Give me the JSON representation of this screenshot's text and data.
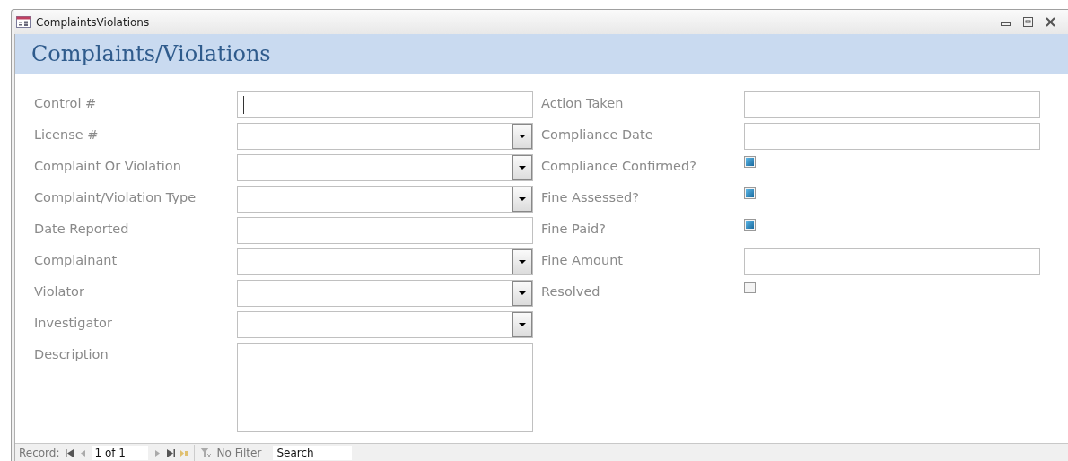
{
  "window": {
    "title": "ComplaintsViolations"
  },
  "header": {
    "title": "Complaints/Violations"
  },
  "left_fields": [
    {
      "label": "Control #",
      "kind": "text",
      "focused": true
    },
    {
      "label": "License #",
      "kind": "combo"
    },
    {
      "label": "Complaint Or Violation",
      "kind": "combo"
    },
    {
      "label": "Complaint/Violation Type",
      "kind": "combo"
    },
    {
      "label": "Date Reported",
      "kind": "text"
    },
    {
      "label": "Complainant",
      "kind": "combo"
    },
    {
      "label": "Violator",
      "kind": "combo"
    },
    {
      "label": "Investigator",
      "kind": "combo"
    },
    {
      "label": "Description",
      "kind": "memo"
    }
  ],
  "right_fields": [
    {
      "label": "Action Taken",
      "kind": "text"
    },
    {
      "label": "Compliance Date",
      "kind": "text"
    },
    {
      "label": "Compliance Confirmed?",
      "kind": "checkbox",
      "checked": false,
      "indeterminate": true
    },
    {
      "label": "Fine Assessed?",
      "kind": "checkbox",
      "checked": false,
      "indeterminate": true
    },
    {
      "label": "Fine Paid?",
      "kind": "checkbox",
      "checked": false,
      "indeterminate": true
    },
    {
      "label": "Fine Amount",
      "kind": "text"
    },
    {
      "label": "Resolved",
      "kind": "checkbox",
      "checked": false,
      "indeterminate": false
    }
  ],
  "status_bar": {
    "record_label": "Record:",
    "position": "1 of 1",
    "filter": "No Filter",
    "search": "Search"
  }
}
